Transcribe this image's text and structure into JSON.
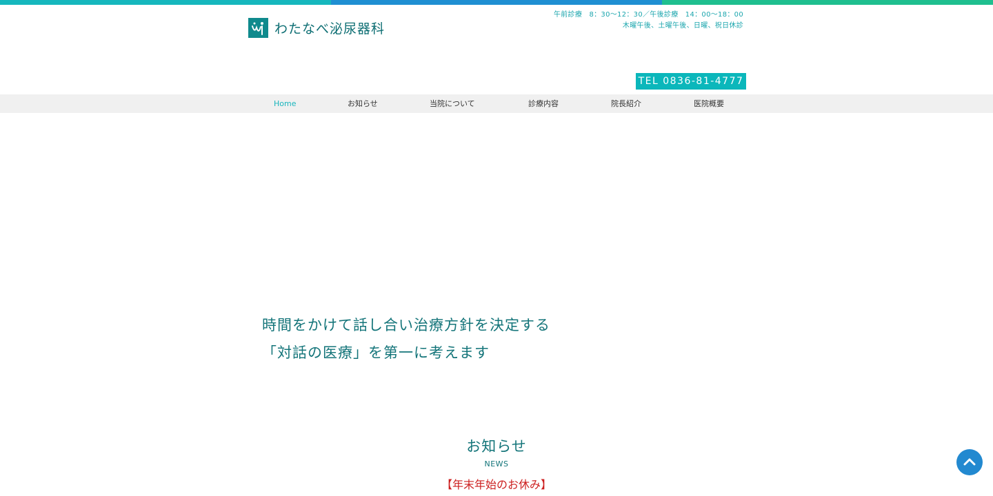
{
  "header": {
    "logo_text": "わたなべ泌尿器科",
    "hours_line1": "午前診療　8：30〜12：30／午後診療　14：00〜18：00",
    "hours_line2": "木曜午後、土曜午後、日曜、祝日休診",
    "tel": "TEL 0836-81-4777"
  },
  "nav": {
    "items": [
      {
        "label": "Home"
      },
      {
        "label": "お知らせ"
      },
      {
        "label": "当院について"
      },
      {
        "label": "診療内容"
      },
      {
        "label": "院長紹介"
      },
      {
        "label": "医院概要"
      }
    ]
  },
  "hero": {
    "line1": "時間をかけて話し合い治療方針を決定する",
    "line2": "「対話の医療」を第一に考えます"
  },
  "news": {
    "title": "お知らせ",
    "subtitle": "NEWS",
    "first_item": "【年末年始のお休み】"
  },
  "colors": {
    "brand": "#0f8a8d",
    "accent": "#0bb7bb",
    "nav_active": "#19b5bd",
    "news_item": "#cc1f1f",
    "to_top": "#2289d0"
  },
  "icons": {
    "logo": "clinic-logo-icon",
    "to_top": "chevron-up-icon"
  }
}
